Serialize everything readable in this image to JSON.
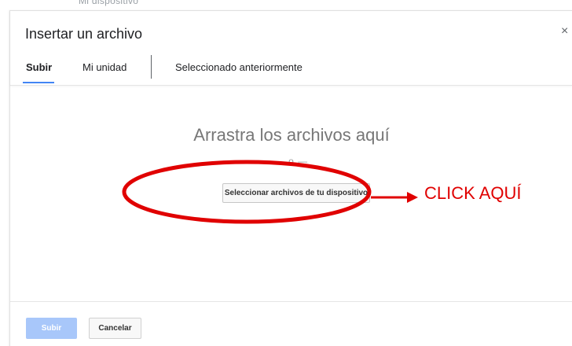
{
  "background": {
    "partial_text": "Mi dispositivo"
  },
  "dialog": {
    "title": "Insertar un archivo",
    "close_glyph": "×",
    "tabs": [
      {
        "label": "Subir",
        "active": true
      },
      {
        "label": "Mi unidad",
        "active": false
      },
      {
        "label": "Seleccionado anteriormente",
        "active": false
      }
    ],
    "drop_text": "Arrastra los archivos aquí",
    "or_text": "— o —",
    "select_button_label": "Seleccionar archivos de tu dispositivo",
    "footer": {
      "submit_label": "Subir",
      "cancel_label": "Cancelar"
    }
  },
  "annotation": {
    "label": "CLICK AQUÍ",
    "color": "#e00000"
  },
  "colors": {
    "accent": "#4285f4",
    "submit_disabled": "#a8c7fa"
  }
}
